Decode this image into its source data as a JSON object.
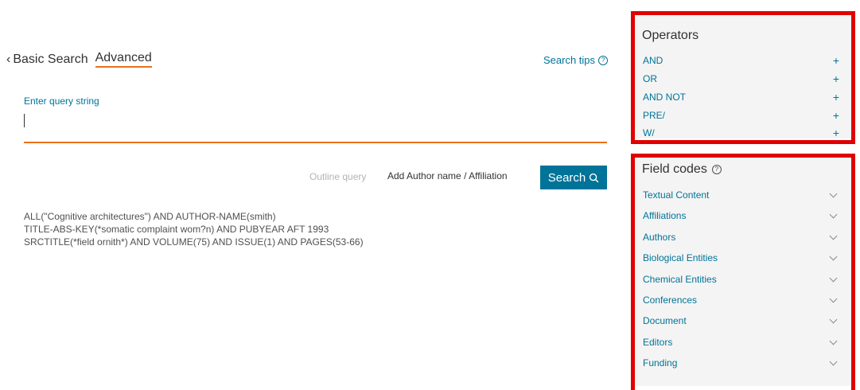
{
  "tabs": {
    "basic_label": "Basic Search",
    "advanced_label": "Advanced"
  },
  "search_tips": "Search tips",
  "query": {
    "label": "Enter query string",
    "value": ""
  },
  "actions": {
    "outline_query": "Outline query",
    "add_author": "Add Author name / Affiliation",
    "search_button": "Search"
  },
  "examples": [
    "ALL(\"Cognitive architectures\") AND AUTHOR-NAME(smith)",
    "TITLE-ABS-KEY(*somatic complaint wom?n) AND PUBYEAR AFT 1993",
    "SRCTITLE(*field ornith*) AND VOLUME(75) AND ISSUE(1) AND PAGES(53-66)"
  ],
  "operators": {
    "title": "Operators",
    "items": [
      "AND",
      "OR",
      "AND NOT",
      "PRE/",
      "W/"
    ]
  },
  "field_codes": {
    "title": "Field codes",
    "items": [
      "Textual Content",
      "Affiliations",
      "Authors",
      "Biological Entities",
      "Chemical Entities",
      "Conferences",
      "Document",
      "Editors",
      "Funding"
    ]
  },
  "icons": {
    "back": "chevron-left-icon",
    "help": "question-circle-icon",
    "search": "magnifier-icon",
    "add": "plus-icon",
    "expand": "chevron-down-icon"
  },
  "colors": {
    "link": "#007398",
    "accent": "#e9711c",
    "highlight": "#e00000",
    "panel": "#f4f4f4"
  }
}
